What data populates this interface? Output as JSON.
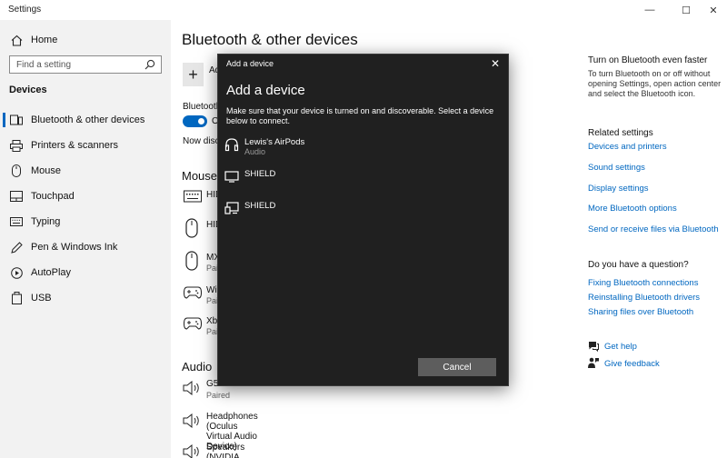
{
  "window": {
    "title": "Settings",
    "minimize_glyph": "—",
    "maximize_glyph": "☐",
    "close_glyph": "✕"
  },
  "sidebar": {
    "home_label": "Home",
    "search_placeholder": "Find a setting",
    "section": "Devices",
    "items": [
      {
        "label": "Bluetooth & other devices",
        "icon": "bluetooth-devices-icon"
      },
      {
        "label": "Printers & scanners",
        "icon": "printer-icon"
      },
      {
        "label": "Mouse",
        "icon": "mouse-icon"
      },
      {
        "label": "Touchpad",
        "icon": "touchpad-icon"
      },
      {
        "label": "Typing",
        "icon": "keyboard-icon"
      },
      {
        "label": "Pen & Windows Ink",
        "icon": "pen-icon"
      },
      {
        "label": "AutoPlay",
        "icon": "autoplay-icon"
      },
      {
        "label": "USB",
        "icon": "usb-icon"
      }
    ]
  },
  "main": {
    "title": "Bluetooth & other devices",
    "add_label": "Ad",
    "bluetooth_label": "Bluetooth",
    "toggle_label": "O",
    "now_discoverable": "Now disco",
    "mouse_section": "Mouse,",
    "devices": [
      {
        "name": "HID",
        "sub": "",
        "icon": "keyboard-icon"
      },
      {
        "name": "HID",
        "sub": "",
        "icon": "mouse-icon"
      },
      {
        "name": "MX",
        "sub": "Pair",
        "icon": "mouse-icon"
      },
      {
        "name": "Wir",
        "sub": "Pair",
        "icon": "gamepad-icon"
      },
      {
        "name": "Xbo",
        "sub": "Pair",
        "icon": "gamepad-icon"
      }
    ],
    "audio_section": "Audio",
    "audio_devices": [
      {
        "name": "G56",
        "sub": "Paired"
      },
      {
        "name": "Headphones (Oculus Virtual Audio Device)",
        "sub": ""
      },
      {
        "name": "Speakers (NVIDIA Broadcast)",
        "sub": ""
      }
    ]
  },
  "right_column": {
    "tip_heading": "Turn on Bluetooth even faster",
    "tip_text": "To turn Bluetooth on or off without opening Settings, open action center and select the Bluetooth icon.",
    "related_heading": "Related settings",
    "related_links": [
      "Devices and printers",
      "Sound settings",
      "Display settings",
      "More Bluetooth options",
      "Send or receive files via Bluetooth"
    ],
    "question_heading": "Do you have a question?",
    "question_links": [
      "Fixing Bluetooth connections",
      "Reinstalling Bluetooth drivers",
      "Sharing files over Bluetooth"
    ],
    "get_help": "Get help",
    "give_feedback": "Give feedback"
  },
  "dialog": {
    "header_title": "Add a device",
    "title": "Add a device",
    "instructions": "Make sure that your device is turned on and discoverable. Select a device below to connect.",
    "devices": [
      {
        "name": "Lewis's AirPods",
        "sub": "Audio",
        "icon": "headphones-icon"
      },
      {
        "name": "SHIELD",
        "sub": "",
        "icon": "monitor-icon"
      },
      {
        "name": "SHIELD",
        "sub": "",
        "icon": "cast-display-icon"
      }
    ],
    "cancel_label": "Cancel",
    "close_glyph": "✕"
  },
  "colors": {
    "accent": "#0067c0",
    "dialog_bg": "#202020",
    "sidebar_bg": "#f2f2f2"
  }
}
